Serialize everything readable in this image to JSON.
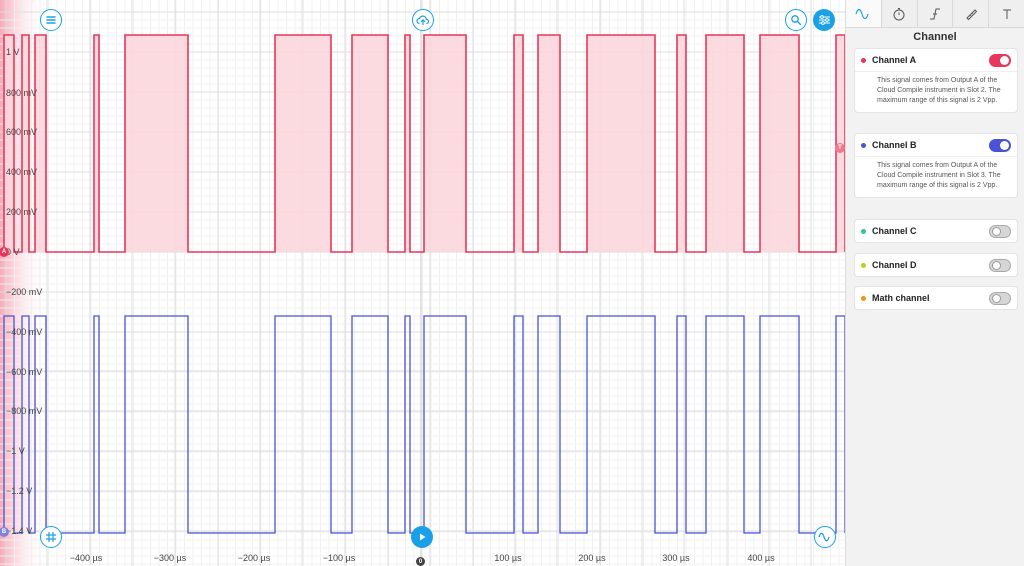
{
  "channel_a": {
    "y_ticks": [
      "1 V",
      "800 mV",
      "600 mV",
      "400 mV",
      "200 mV",
      "0 V"
    ],
    "marker": "A",
    "color": "#e8375a",
    "fill": "#fbd6dd"
  },
  "channel_b": {
    "y_ticks": [
      "−200 mV",
      "−400 mV",
      "−600 mV",
      "−800 mV",
      "−1 V",
      "−1.2 V",
      "−1.4 V"
    ],
    "marker": "B",
    "color": "#4a52d6"
  },
  "trigger_marker": "T",
  "x_ticks": [
    "−400 µs",
    "−300 µs",
    "−200 µs",
    "−100 µs",
    "100 µs",
    "200 µs",
    "300 µs",
    "400 µs"
  ],
  "time_zero_marker": "0",
  "icons": {
    "menu": "menu-icon",
    "cloud": "cloud-upload-icon",
    "search": "search-icon",
    "settings": "sliders-icon",
    "grid": "grid-icon",
    "play": "play-icon",
    "wave": "sine-wave-icon"
  },
  "sidebar": {
    "tabs": [
      {
        "name": "channel-tab",
        "icon": "sine-wave-icon",
        "active": true
      },
      {
        "name": "timebase-tab",
        "icon": "stopwatch-icon",
        "active": false
      },
      {
        "name": "trigger-tab",
        "icon": "trigger-edge-icon",
        "active": false
      },
      {
        "name": "measure-tab",
        "icon": "ruler-icon",
        "active": false
      },
      {
        "name": "cursor-tab",
        "icon": "cursor-icon",
        "active": false
      }
    ],
    "title": "Channel",
    "channels": [
      {
        "name": "Channel A",
        "color": "#e8375a",
        "enabled": true,
        "description": "This signal comes from Output A of the Cloud Compile instrument in Slot 2. The maximum range of this signal is 2 Vpp."
      },
      {
        "name": "Channel B",
        "color": "#4a52d6",
        "enabled": true,
        "description": "This signal comes from Output A of the Cloud Compile instrument in Slot 3. The maximum range of this signal is 2 Vpp."
      },
      {
        "name": "Channel C",
        "color": "#2ec4a0",
        "enabled": false
      },
      {
        "name": "Channel D",
        "color": "#b5d320",
        "enabled": false
      },
      {
        "name": "Math channel",
        "color": "#f39020",
        "enabled": false
      }
    ]
  }
}
